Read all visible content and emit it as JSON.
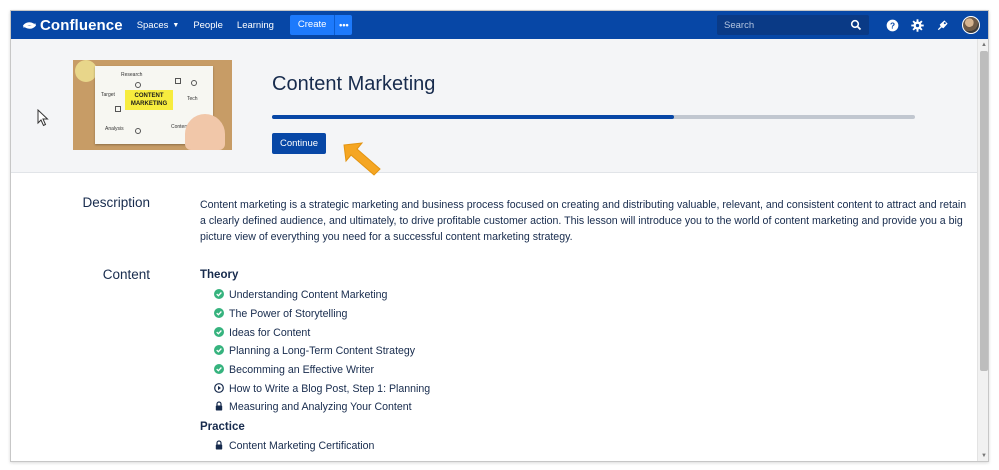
{
  "nav": {
    "logo_text": "Confluence",
    "items": [
      {
        "label": "Spaces",
        "has_dropdown": true
      },
      {
        "label": "People",
        "has_dropdown": false
      },
      {
        "label": "Learning",
        "has_dropdown": false
      }
    ],
    "create_label": "Create",
    "more_label": "•••",
    "search_placeholder": "Search",
    "icons": [
      "help-icon",
      "settings-icon",
      "notifications-icon"
    ],
    "brand_color": "#0747a6"
  },
  "hero": {
    "title": "Content Marketing",
    "image_words": [
      "CONTENT",
      "MARKETING",
      "Research",
      "Target",
      "Tech",
      "Analysis",
      "Content"
    ],
    "progress_fraction": 0.625,
    "continue_label": "Continue"
  },
  "description": {
    "label": "Description",
    "text": "Content marketing is a strategic marketing and business process focused on creating and distributing valuable, relevant, and consistent content to attract and retain a clearly defined audience, and ultimately, to drive profitable customer action. This lesson will introduce you to the world of content marketing and provide you a big picture view of everything you need for a successful content marketing strategy."
  },
  "content": {
    "label": "Content",
    "groups": [
      {
        "title": "Theory",
        "lessons": [
          {
            "title": "Understanding Content Marketing",
            "status": "complete"
          },
          {
            "title": "The Power of Storytelling",
            "status": "complete"
          },
          {
            "title": "Ideas for Content",
            "status": "complete"
          },
          {
            "title": "Planning a Long-Term Content Strategy",
            "status": "complete"
          },
          {
            "title": "Becomming an Effective Writer",
            "status": "complete"
          },
          {
            "title": "How to Write a Blog Post, Step 1: Planning",
            "status": "in-progress"
          },
          {
            "title": "Measuring and Analyzing Your Content",
            "status": "locked"
          }
        ]
      },
      {
        "title": "Practice",
        "lessons": [
          {
            "title": "Content Marketing Certification",
            "status": "locked"
          }
        ]
      }
    ]
  },
  "colors": {
    "complete": "#36b37e",
    "in_progress": "#172b4d",
    "locked": "#172b4d",
    "arrow": "#f5a623"
  }
}
